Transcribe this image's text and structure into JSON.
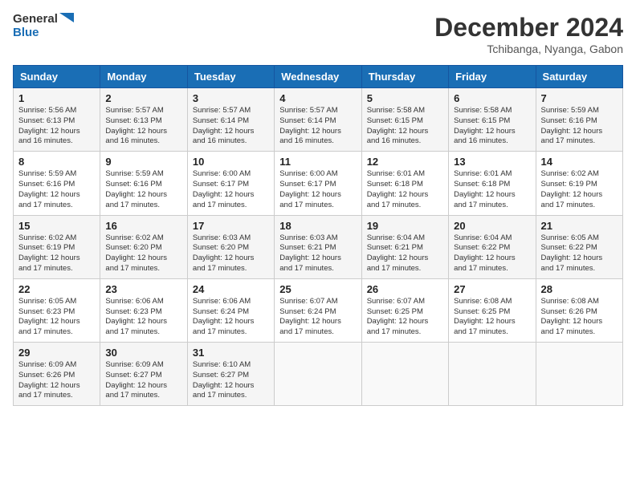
{
  "header": {
    "logo_line1": "General",
    "logo_line2": "Blue",
    "month": "December 2024",
    "location": "Tchibanga, Nyanga, Gabon"
  },
  "weekdays": [
    "Sunday",
    "Monday",
    "Tuesday",
    "Wednesday",
    "Thursday",
    "Friday",
    "Saturday"
  ],
  "weeks": [
    [
      {
        "day": "1",
        "info": "Sunrise: 5:56 AM\nSunset: 6:13 PM\nDaylight: 12 hours\nand 16 minutes."
      },
      {
        "day": "2",
        "info": "Sunrise: 5:57 AM\nSunset: 6:13 PM\nDaylight: 12 hours\nand 16 minutes."
      },
      {
        "day": "3",
        "info": "Sunrise: 5:57 AM\nSunset: 6:14 PM\nDaylight: 12 hours\nand 16 minutes."
      },
      {
        "day": "4",
        "info": "Sunrise: 5:57 AM\nSunset: 6:14 PM\nDaylight: 12 hours\nand 16 minutes."
      },
      {
        "day": "5",
        "info": "Sunrise: 5:58 AM\nSunset: 6:15 PM\nDaylight: 12 hours\nand 16 minutes."
      },
      {
        "day": "6",
        "info": "Sunrise: 5:58 AM\nSunset: 6:15 PM\nDaylight: 12 hours\nand 16 minutes."
      },
      {
        "day": "7",
        "info": "Sunrise: 5:59 AM\nSunset: 6:16 PM\nDaylight: 12 hours\nand 17 minutes."
      }
    ],
    [
      {
        "day": "8",
        "info": "Sunrise: 5:59 AM\nSunset: 6:16 PM\nDaylight: 12 hours\nand 17 minutes."
      },
      {
        "day": "9",
        "info": "Sunrise: 5:59 AM\nSunset: 6:16 PM\nDaylight: 12 hours\nand 17 minutes."
      },
      {
        "day": "10",
        "info": "Sunrise: 6:00 AM\nSunset: 6:17 PM\nDaylight: 12 hours\nand 17 minutes."
      },
      {
        "day": "11",
        "info": "Sunrise: 6:00 AM\nSunset: 6:17 PM\nDaylight: 12 hours\nand 17 minutes."
      },
      {
        "day": "12",
        "info": "Sunrise: 6:01 AM\nSunset: 6:18 PM\nDaylight: 12 hours\nand 17 minutes."
      },
      {
        "day": "13",
        "info": "Sunrise: 6:01 AM\nSunset: 6:18 PM\nDaylight: 12 hours\nand 17 minutes."
      },
      {
        "day": "14",
        "info": "Sunrise: 6:02 AM\nSunset: 6:19 PM\nDaylight: 12 hours\nand 17 minutes."
      }
    ],
    [
      {
        "day": "15",
        "info": "Sunrise: 6:02 AM\nSunset: 6:19 PM\nDaylight: 12 hours\nand 17 minutes."
      },
      {
        "day": "16",
        "info": "Sunrise: 6:02 AM\nSunset: 6:20 PM\nDaylight: 12 hours\nand 17 minutes."
      },
      {
        "day": "17",
        "info": "Sunrise: 6:03 AM\nSunset: 6:20 PM\nDaylight: 12 hours\nand 17 minutes."
      },
      {
        "day": "18",
        "info": "Sunrise: 6:03 AM\nSunset: 6:21 PM\nDaylight: 12 hours\nand 17 minutes."
      },
      {
        "day": "19",
        "info": "Sunrise: 6:04 AM\nSunset: 6:21 PM\nDaylight: 12 hours\nand 17 minutes."
      },
      {
        "day": "20",
        "info": "Sunrise: 6:04 AM\nSunset: 6:22 PM\nDaylight: 12 hours\nand 17 minutes."
      },
      {
        "day": "21",
        "info": "Sunrise: 6:05 AM\nSunset: 6:22 PM\nDaylight: 12 hours\nand 17 minutes."
      }
    ],
    [
      {
        "day": "22",
        "info": "Sunrise: 6:05 AM\nSunset: 6:23 PM\nDaylight: 12 hours\nand 17 minutes."
      },
      {
        "day": "23",
        "info": "Sunrise: 6:06 AM\nSunset: 6:23 PM\nDaylight: 12 hours\nand 17 minutes."
      },
      {
        "day": "24",
        "info": "Sunrise: 6:06 AM\nSunset: 6:24 PM\nDaylight: 12 hours\nand 17 minutes."
      },
      {
        "day": "25",
        "info": "Sunrise: 6:07 AM\nSunset: 6:24 PM\nDaylight: 12 hours\nand 17 minutes."
      },
      {
        "day": "26",
        "info": "Sunrise: 6:07 AM\nSunset: 6:25 PM\nDaylight: 12 hours\nand 17 minutes."
      },
      {
        "day": "27",
        "info": "Sunrise: 6:08 AM\nSunset: 6:25 PM\nDaylight: 12 hours\nand 17 minutes."
      },
      {
        "day": "28",
        "info": "Sunrise: 6:08 AM\nSunset: 6:26 PM\nDaylight: 12 hours\nand 17 minutes."
      }
    ],
    [
      {
        "day": "29",
        "info": "Sunrise: 6:09 AM\nSunset: 6:26 PM\nDaylight: 12 hours\nand 17 minutes."
      },
      {
        "day": "30",
        "info": "Sunrise: 6:09 AM\nSunset: 6:27 PM\nDaylight: 12 hours\nand 17 minutes."
      },
      {
        "day": "31",
        "info": "Sunrise: 6:10 AM\nSunset: 6:27 PM\nDaylight: 12 hours\nand 17 minutes."
      },
      {
        "day": "",
        "info": ""
      },
      {
        "day": "",
        "info": ""
      },
      {
        "day": "",
        "info": ""
      },
      {
        "day": "",
        "info": ""
      }
    ]
  ]
}
